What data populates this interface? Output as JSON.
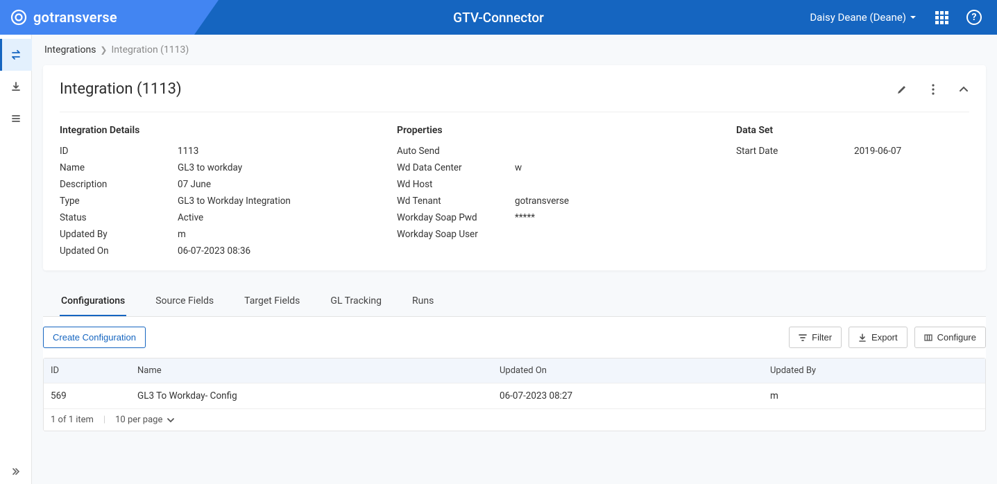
{
  "header": {
    "brand": "gotransverse",
    "app_title": "GTV-Connector",
    "user_display": "Daisy Deane (Deane)"
  },
  "breadcrumb": {
    "root": "Integrations",
    "current": "Integration (1113)"
  },
  "card": {
    "title": "Integration (1113)",
    "details_heading": "Integration Details",
    "properties_heading": "Properties",
    "dataset_heading": "Data Set",
    "details": {
      "id_label": "ID",
      "id_value": "1113",
      "name_label": "Name",
      "name_value": "GL3 to workday",
      "desc_label": "Description",
      "desc_value": "07 June",
      "type_label": "Type",
      "type_value": "GL3 to Workday Integration",
      "status_label": "Status",
      "status_value": "Active",
      "updby_label": "Updated By",
      "updby_value": "m",
      "updon_label": "Updated On",
      "updon_value": "06-07-2023 08:36"
    },
    "properties": {
      "autosend_label": "Auto Send",
      "autosend_value": "",
      "wddc_label": "Wd Data Center",
      "wddc_value": "w",
      "wdhost_label": "Wd Host",
      "wdhost_value": "",
      "wdtenant_label": "Wd Tenant",
      "wdtenant_value": "gotransverse",
      "wdsoappwd_label": "Workday Soap Pwd",
      "wdsoappwd_value": "*****",
      "wdsoapuser_label": "Workday Soap User",
      "wdsoapuser_value": ""
    },
    "dataset": {
      "startdate_label": "Start Date",
      "startdate_value": "2019-06-07"
    }
  },
  "tabs": {
    "t1": "Configurations",
    "t2": "Source Fields",
    "t3": "Target Fields",
    "t4": "GL Tracking",
    "t5": "Runs"
  },
  "actions": {
    "create_config": "Create Configuration",
    "filter": "Filter",
    "export": "Export",
    "configure": "Configure"
  },
  "table": {
    "headers": {
      "id": "ID",
      "name": "Name",
      "updated_on": "Updated On",
      "updated_by": "Updated By"
    },
    "rows": [
      {
        "id": "569",
        "name": "GL3 To Workday- Config",
        "updated_on": "06-07-2023 08:27",
        "updated_by": "m"
      }
    ],
    "pager": {
      "summary": "1 of 1 item",
      "per_page": "10 per page"
    }
  }
}
